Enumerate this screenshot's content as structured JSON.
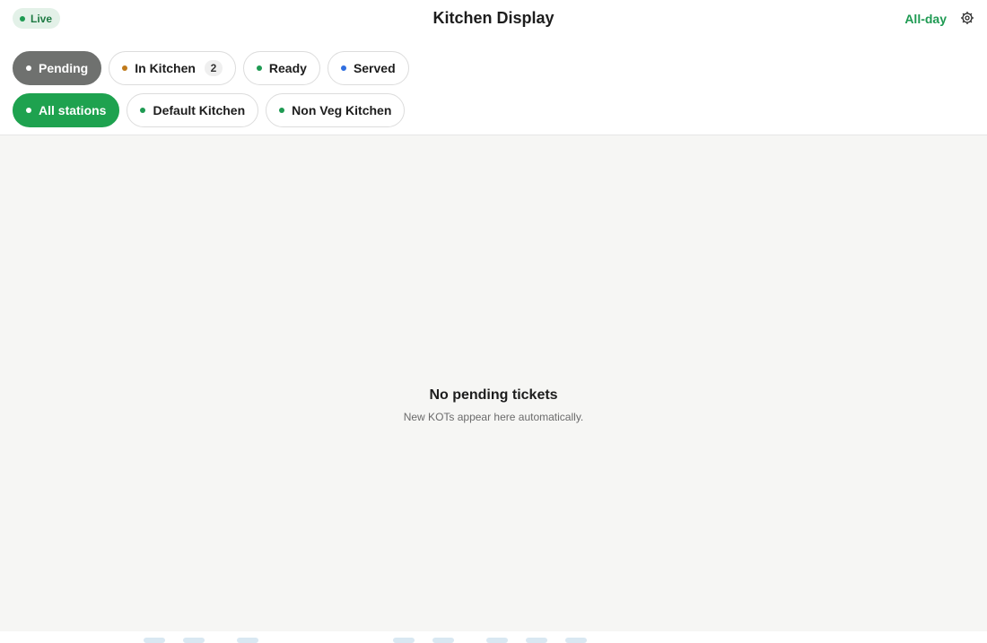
{
  "header": {
    "live_label": "Live",
    "title": "Kitchen Display",
    "allday_label": "All-day",
    "settings_icon": "gear-icon"
  },
  "status_tabs": [
    {
      "label": "Pending",
      "dot_color": "#ffffff",
      "active": true
    },
    {
      "label": "In Kitchen",
      "dot_color": "#c07a1a",
      "count": "2"
    },
    {
      "label": "Ready",
      "dot_color": "#1e9a52"
    },
    {
      "label": "Served",
      "dot_color": "#2f6ee0"
    }
  ],
  "station_tabs": [
    {
      "label": "All stations",
      "dot_color": "#ffffff",
      "active": true
    },
    {
      "label": "Default Kitchen",
      "dot_color": "#1e9a52"
    },
    {
      "label": "Non Veg Kitchen",
      "dot_color": "#1e9a52"
    }
  ],
  "empty_state": {
    "title": "No pending tickets",
    "subtitle": "New KOTs appear here automatically."
  },
  "colors": {
    "accent_green": "#1ea24f",
    "active_gray": "#6f716f",
    "in_kitchen": "#c07a1a",
    "served": "#2f6ee0"
  }
}
